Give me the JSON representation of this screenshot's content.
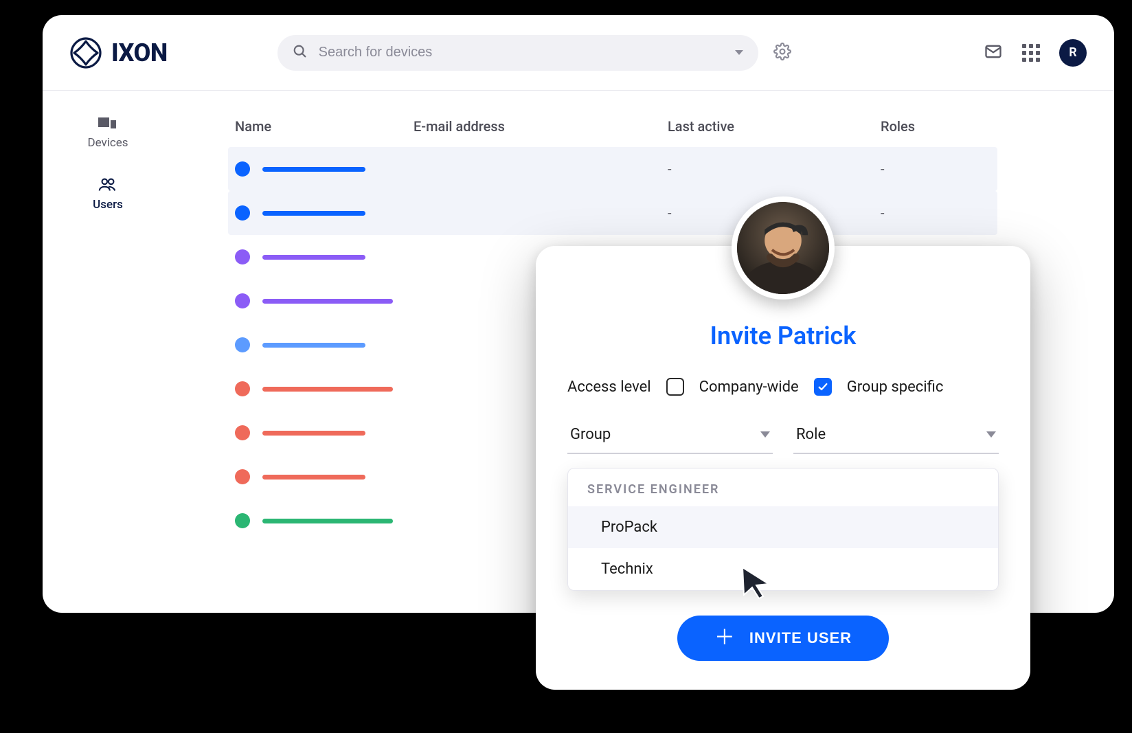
{
  "brand": {
    "name": "IXON"
  },
  "search": {
    "placeholder": "Search for devices"
  },
  "header": {
    "avatar_initial": "R"
  },
  "sidebar": {
    "items": [
      {
        "label": "Devices",
        "active": false
      },
      {
        "label": "Users",
        "active": true
      }
    ]
  },
  "table": {
    "columns": [
      "Name",
      "E-mail address",
      "Last active",
      "Roles"
    ],
    "rows": [
      {
        "color": "#0a63ff",
        "email_color": "#0a63ff",
        "name_w": 150,
        "email_w": 250,
        "selected": true,
        "last_active": "-",
        "roles": "-"
      },
      {
        "color": "#0a63ff",
        "email_color": "#0a63ff",
        "name_w": 150,
        "email_w": 180,
        "selected": true,
        "last_active": "-",
        "roles": "-"
      },
      {
        "color": "#8b5cf6",
        "email_color": "#cfcfda",
        "name_w": 150,
        "email_w": 220,
        "selected": false,
        "last_active": "",
        "roles": ""
      },
      {
        "color": "#8b5cf6",
        "email_color": "#cfcfda",
        "name_w": 190,
        "email_w": 180,
        "selected": false,
        "last_active": "",
        "roles": ""
      },
      {
        "color": "#5c9bff",
        "email_color": "#cfcfda",
        "name_w": 150,
        "email_w": 250,
        "selected": false,
        "last_active": "",
        "roles": ""
      },
      {
        "color": "#ef6a5a",
        "email_color": "#cfcfda",
        "name_w": 190,
        "email_w": 180,
        "selected": false,
        "last_active": "",
        "roles": ""
      },
      {
        "color": "#ef6a5a",
        "email_color": "#cfcfda",
        "name_w": 150,
        "email_w": 220,
        "selected": false,
        "last_active": "",
        "roles": ""
      },
      {
        "color": "#ef6a5a",
        "email_color": "#cfcfda",
        "name_w": 150,
        "email_w": 250,
        "selected": false,
        "last_active": "",
        "roles": ""
      },
      {
        "color": "#2bb673",
        "email_color": "#cfcfda",
        "name_w": 190,
        "email_w": 180,
        "selected": false,
        "last_active": "",
        "roles": ""
      }
    ]
  },
  "invite": {
    "title": "Invite Patrick",
    "access_label": "Access level",
    "company_wide_label": "Company-wide",
    "company_wide_checked": false,
    "group_specific_label": "Group specific",
    "group_specific_checked": true,
    "group_field_label": "Group",
    "role_field_label": "Role",
    "dropdown": {
      "section": "SERVICE ENGINEER",
      "options": [
        "ProPack",
        "Technix"
      ],
      "hovered_index": 0
    },
    "button_label": "INVITE USER"
  },
  "colors": {
    "brand_navy": "#0b1a44",
    "primary_blue": "#0a63ff",
    "grey": "#cfcfda"
  }
}
